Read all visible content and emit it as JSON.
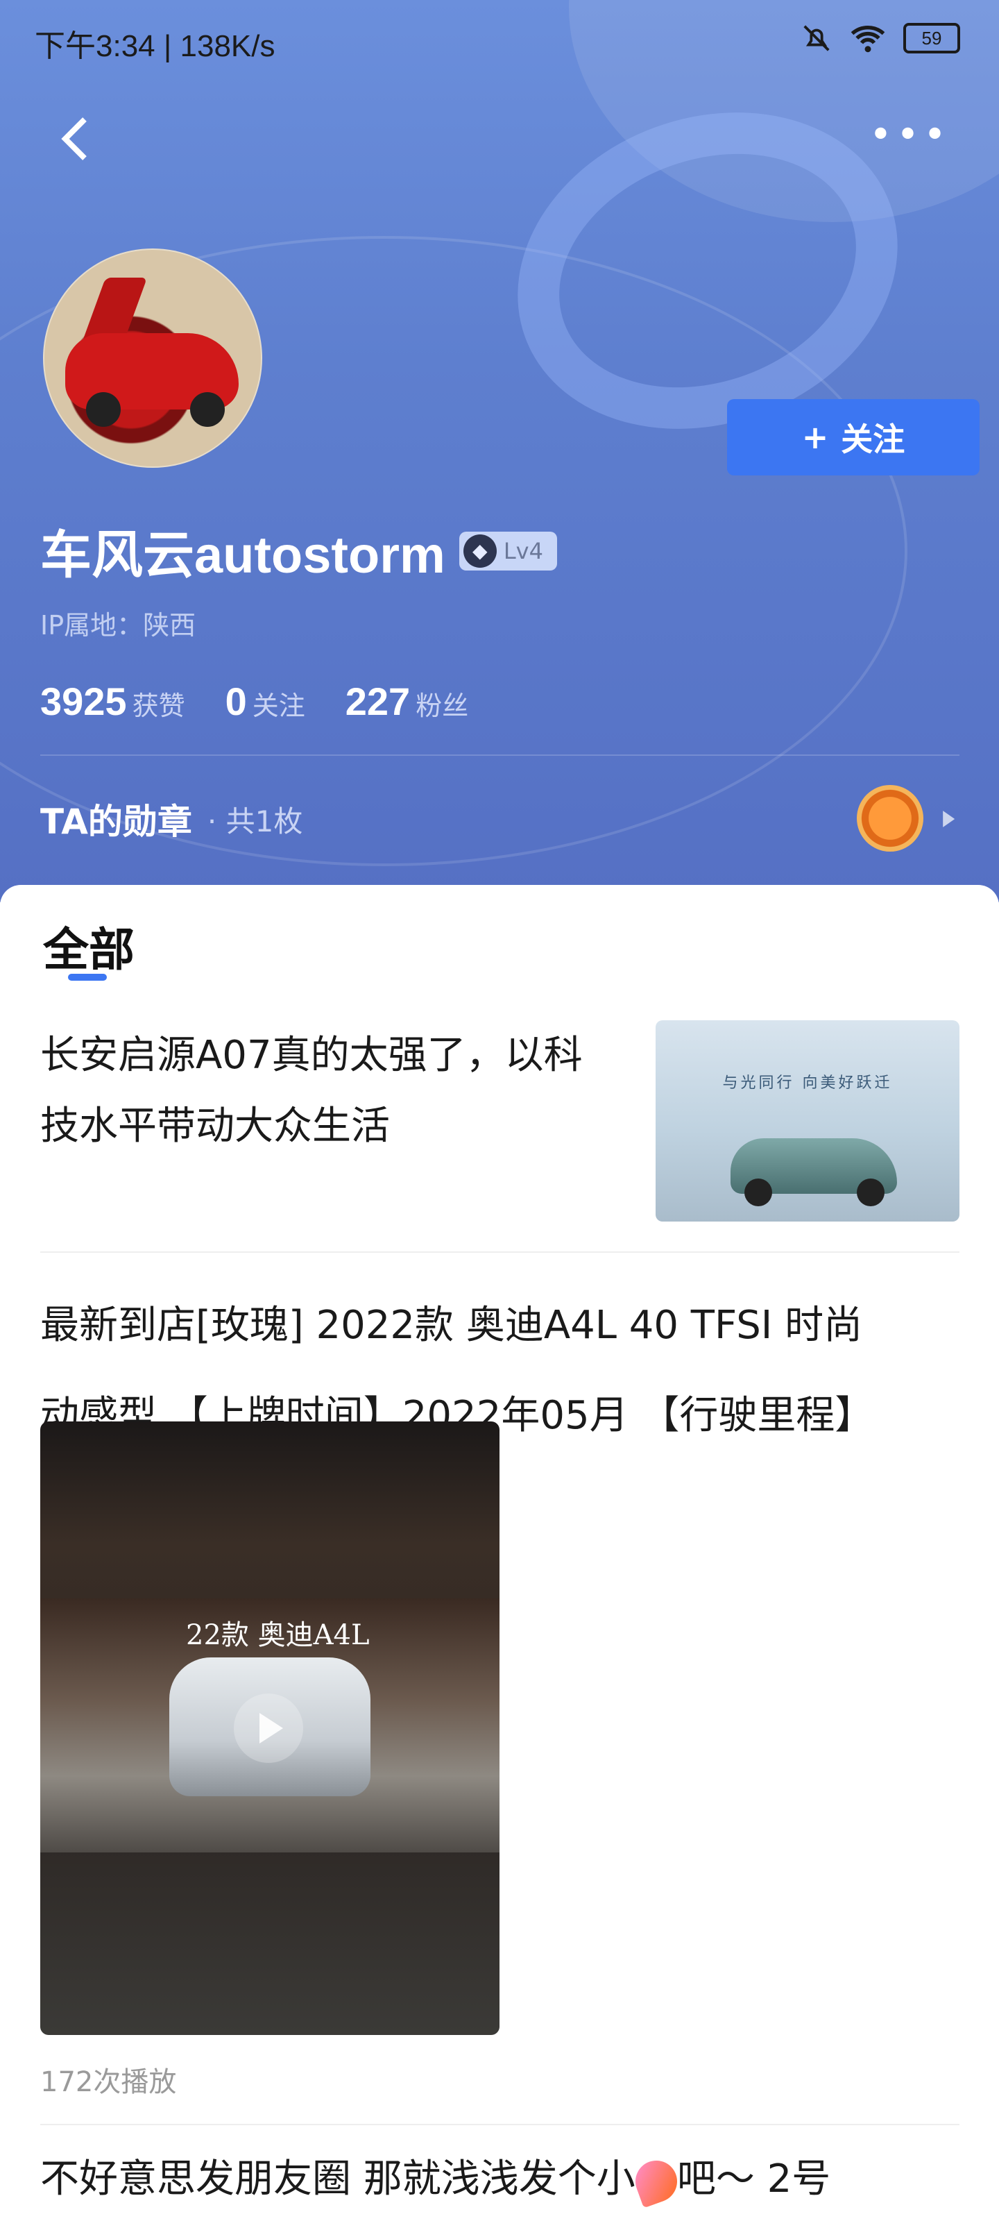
{
  "status": {
    "time": "下午3:34 | 138K/s",
    "battery": "59"
  },
  "profile": {
    "follow_label": "关注",
    "name": "车风云autostorm",
    "level": "Lv4",
    "ip": "IP属地：陕西",
    "stats": [
      {
        "num": "3925",
        "label": "获赞"
      },
      {
        "num": "0",
        "label": "关注"
      },
      {
        "num": "227",
        "label": "粉丝"
      }
    ],
    "medal": {
      "title": "TA的勋章",
      "count": "· 共1枚"
    }
  },
  "tabs": {
    "active": "全部"
  },
  "posts": [
    {
      "title": "长安启源A07真的太强了，以科技水平带动大众生活",
      "thumb_text": "与光同行  向美好跃迁"
    },
    {
      "title_line1": "最新到店[玫瑰] 2022款 奥迪A4L 40 TFSI 时尚",
      "title_line2": "动感型 【上牌时间】2022年05月 【行驶里程】",
      "video_text": "22款 奥迪A4L",
      "plays": "172次播放"
    },
    {
      "title_before": "不好意思发朋友圈 那就浅浅发个小",
      "title_after": "吧～ 2号"
    }
  ]
}
